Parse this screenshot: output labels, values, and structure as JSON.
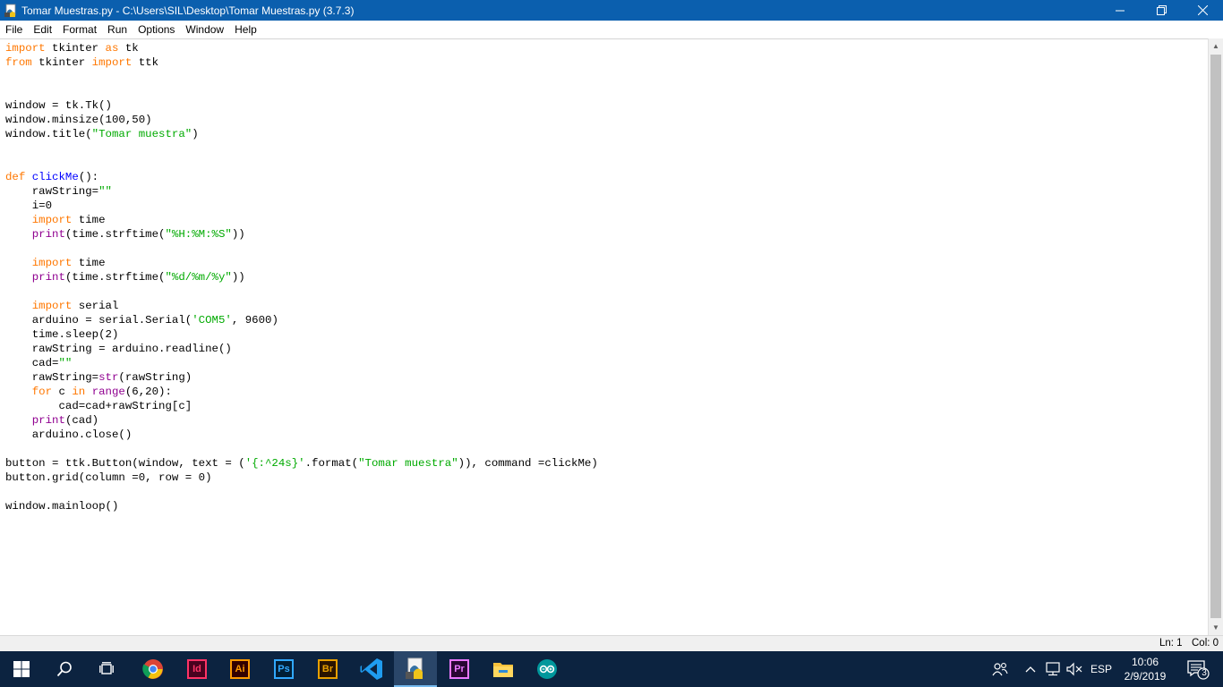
{
  "window": {
    "title": "Tomar Muestras.py - C:\\Users\\SIL\\Desktop\\Tomar Muestras.py (3.7.3)"
  },
  "menu": {
    "items": [
      "File",
      "Edit",
      "Format",
      "Run",
      "Options",
      "Window",
      "Help"
    ]
  },
  "code_lines": [
    "import tkinter as tk",
    "from tkinter import ttk",
    "",
    "",
    "window = tk.Tk()",
    "window.minsize(100,50)",
    "window.title(\"Tomar muestra\")",
    "",
    "",
    "def clickMe():",
    "    rawString=\"\"",
    "    i=0",
    "    import time",
    "    print(time.strftime(\"%H:%M:%S\"))",
    "",
    "    import time",
    "    print(time.strftime(\"%d/%m/%y\"))",
    "",
    "    import serial",
    "    arduino = serial.Serial('COM5', 9600)",
    "    time.sleep(2)",
    "    rawString = arduino.readline()",
    "    cad=\"\"",
    "    rawString=str(rawString)",
    "    for c in range(6,20):",
    "        cad=cad+rawString[c]",
    "    print(cad)",
    "    arduino.close()",
    "",
    "button = ttk.Button(window, text = ('{:^24s}'.format(\"Tomar muestra\")), command =clickMe)",
    "button.grid(column =0, row = 0)",
    "",
    "window.mainloop()"
  ],
  "status": {
    "ln": "Ln: 1",
    "col": "Col: 0"
  },
  "taskbar": {
    "apps": [
      "start",
      "search",
      "task-view",
      "chrome",
      "indesign",
      "illustrator",
      "photoshop",
      "bridge",
      "vscode",
      "python-idle",
      "premiere",
      "file-explorer",
      "arduino"
    ],
    "active_app": "python-idle",
    "indesign_label": "Id",
    "illustrator_label": "Ai",
    "photoshop_label": "Ps",
    "bridge_label": "Br",
    "premiere_label": "Pr",
    "language": "ESP",
    "time": "10:06",
    "date": "2/9/2019",
    "notification_count": "3"
  },
  "colors": {
    "titlebar": "#0b5fae",
    "keyword": "#ff7700",
    "builtin": "#900090",
    "definition": "#0000ff",
    "string": "#00aa00",
    "taskbar": "#0c2340"
  }
}
